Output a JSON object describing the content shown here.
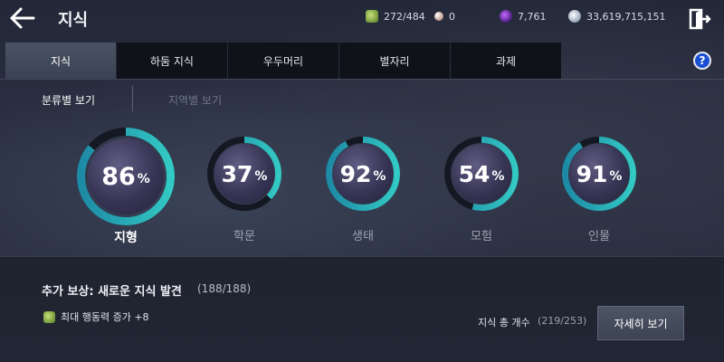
{
  "header": {
    "title": "지식",
    "back_icon": "arrow-left-icon",
    "exit_icon": "exit-door-icon"
  },
  "currencies": {
    "stamina": "272/484",
    "pearl": "0",
    "orb": "7,761",
    "silver": "33,619,715,151"
  },
  "tabs": [
    {
      "label": "지식",
      "active": true
    },
    {
      "label": "하둠 지식",
      "active": false
    },
    {
      "label": "우두머리",
      "active": false
    },
    {
      "label": "별자리",
      "active": false
    },
    {
      "label": "과제",
      "active": false
    }
  ],
  "help_label": "?",
  "subtabs": {
    "by_category": "분류별 보기",
    "by_region": "지역별 보기"
  },
  "categories": [
    {
      "label": "지형",
      "percent": 86,
      "active": true
    },
    {
      "label": "학문",
      "percent": 37,
      "active": false
    },
    {
      "label": "생태",
      "percent": 92,
      "active": false
    },
    {
      "label": "모험",
      "percent": 54,
      "active": false
    },
    {
      "label": "인물",
      "percent": 91,
      "active": false
    }
  ],
  "percent_sign": "%",
  "reward": {
    "title": "추가 보상: 새로운 지식 발견",
    "progress": "(188/188)",
    "detail": "최대 행동력 증가 +8"
  },
  "total": {
    "label": "지식 총 개수",
    "value": "(219/253)"
  },
  "detail_button": "자세히 보기",
  "colors": {
    "ring_progress": "#33c9c4",
    "ring_progress_dark": "#1e8aa6",
    "ring_track": "#141822",
    "tab_active": "#434b5c",
    "help": "#1a4fd1"
  }
}
